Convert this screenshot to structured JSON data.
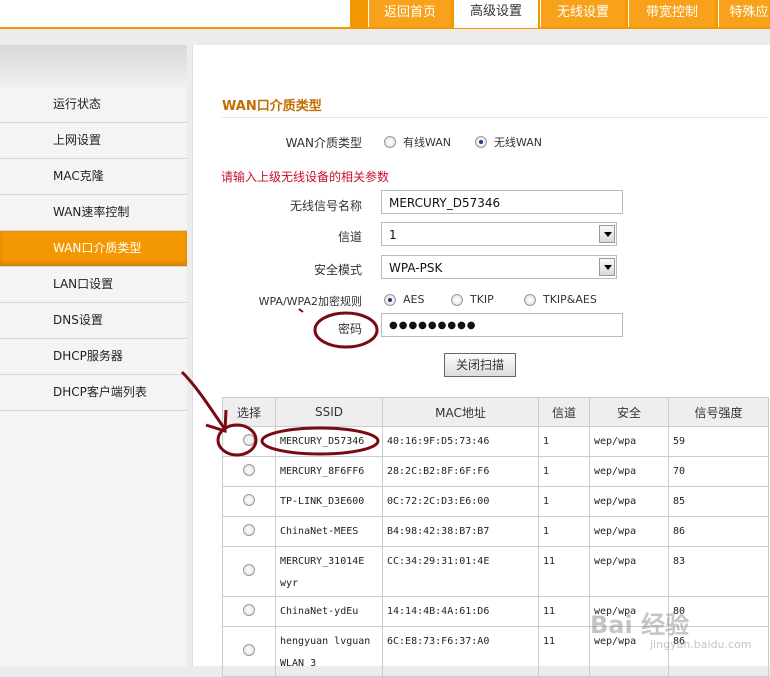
{
  "top_tabs": [
    "返回首页",
    "高级设置",
    "无线设置",
    "带宽控制",
    "特殊应"
  ],
  "active_tab_index": 1,
  "sidebar": {
    "items": [
      "运行状态",
      "上网设置",
      "MAC克隆",
      "WAN速率控制",
      "WAN口介质类型",
      "LAN口设置",
      "DNS设置",
      "DHCP服务器",
      "DHCP客户端列表"
    ],
    "active_index": 4
  },
  "section_title": "WAN口介质类型",
  "media": {
    "label": "WAN介质类型",
    "options": [
      "有线WAN",
      "无线WAN"
    ],
    "selected": "无线WAN"
  },
  "notice": "请输入上级无线设备的相关参数",
  "form": {
    "ssid_label": "无线信号名称",
    "ssid_value": "MERCURY_D57346",
    "channel_label": "信道",
    "channel_value": "1",
    "security_label": "安全模式",
    "security_value": "WPA-PSK",
    "encryption_label": "WPA/WPA2加密规则",
    "encryption_options": [
      "AES",
      "TKIP",
      "TKIP&AES"
    ],
    "encryption_selected": "AES",
    "password_label": "密码",
    "password_value": "●●●●●●●●●"
  },
  "close_scan_button": "关闭扫描",
  "table": {
    "headers": [
      "选择",
      "SSID",
      "MAC地址",
      "信道",
      "安全",
      "信号强度"
    ],
    "rows": [
      {
        "ssid": "MERCURY_D57346",
        "mac": "40:16:9F:D5:73:46",
        "channel": "1",
        "security": "wep/wpa",
        "signal": "59"
      },
      {
        "ssid": "MERCURY_8F6FF6",
        "mac": "28:2C:B2:8F:6F:F6",
        "channel": "1",
        "security": "wep/wpa",
        "signal": "70"
      },
      {
        "ssid": "TP-LINK_D3E600",
        "mac": "0C:72:2C:D3:E6:00",
        "channel": "1",
        "security": "wep/wpa",
        "signal": "85"
      },
      {
        "ssid": "ChinaNet-MEES",
        "mac": "B4:98:42:38:B7:B7",
        "channel": "1",
        "security": "wep/wpa",
        "signal": "86"
      },
      {
        "ssid": "MERCURY_31014E wyr",
        "mac": "CC:34:29:31:01:4E",
        "channel": "11",
        "security": "wep/wpa",
        "signal": "83"
      },
      {
        "ssid": "ChinaNet-ydEu",
        "mac": "14:14:4B:4A:61:D6",
        "channel": "11",
        "security": "wep/wpa",
        "signal": "80"
      },
      {
        "ssid": "hengyuan lvguan WLAN 3",
        "mac": "6C:E8:73:F6:37:A0",
        "channel": "11",
        "security": "wep/wpa",
        "signal": "86"
      }
    ]
  },
  "watermark": {
    "brand": "Bai 经验",
    "url": "jingyan.baidu.com"
  },
  "colors": {
    "accent": "#f39800",
    "annotation": "#7a0a12",
    "notice": "#c8102e"
  }
}
